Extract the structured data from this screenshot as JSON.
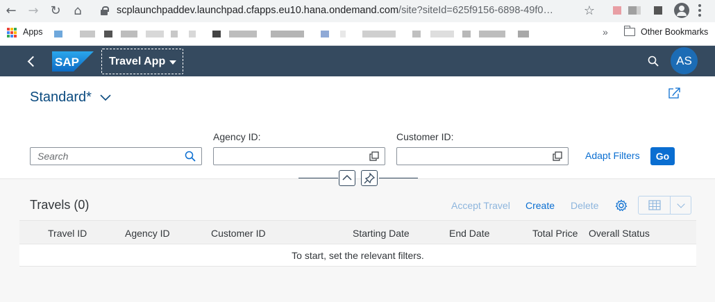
{
  "browser": {
    "url_host": "scplaunchpaddev.launchpad.cfapps.eu10.hana.ondemand.com",
    "url_path": "/site?siteId=625f9156-6898-49f0…",
    "bookmarks": {
      "apps_label": "Apps",
      "other_bookmarks": "Other Bookmarks"
    }
  },
  "shell": {
    "app_title": "Travel App",
    "avatar_initials": "AS",
    "brand_color": "#354a5f",
    "avatar_color": "#1c6cb5"
  },
  "header": {
    "variant_name": "Standard*",
    "search_placeholder": "Search",
    "agency_label": "Agency ID:",
    "customer_label": "Customer ID:",
    "adapt_filters": "Adapt Filters",
    "go": "Go",
    "accent_color": "#0a6ed1"
  },
  "table": {
    "title": "Travels (0)",
    "toolbar": {
      "accept": "Accept Travel",
      "create": "Create",
      "delete": "Delete"
    },
    "columns": [
      "Travel ID",
      "Agency ID",
      "Customer ID",
      "Starting Date",
      "End Date",
      "Total Price",
      "Overall Status"
    ],
    "no_data": "To start, set the relevant filters."
  }
}
